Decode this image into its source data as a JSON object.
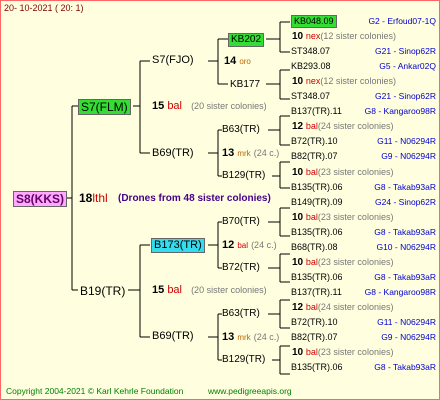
{
  "header": {
    "date": "20- 10-2021 ( 20: 1)"
  },
  "footer": {
    "copyright": "Copyright 2004-2021 © Karl Kehrle Foundation",
    "site": "www.pedigreeapis.org"
  },
  "colors": {
    "female_box": "#33dd33",
    "selected_box": "#33ddee",
    "root_box": "#ffaaff",
    "frame": "#ff6666",
    "lines": "#000000",
    "code_text": "#0000cc",
    "tag_text": "#cc0000"
  },
  "root": {
    "name": "S8(KKS)",
    "gen": "18",
    "tag": "lthl",
    "drones": "(Drones from 48 sister colonies)"
  },
  "g1": {
    "top": {
      "name": "S7(FLM)",
      "gen": "15",
      "tag": "bal",
      "note": "(20 sister colonies)"
    },
    "bottom": {
      "name": "B19(TR)",
      "gen": "15",
      "tag": "bal",
      "note": "(20 sister colonies)"
    }
  },
  "g2": {
    "a": {
      "name": "S7(FJO)",
      "gen": "14",
      "tag": "oro"
    },
    "b": {
      "name": "B69(TR)",
      "gen": "13",
      "tag": "mrk",
      "note": "(24 c.)"
    },
    "c": {
      "name": "B173(TR)",
      "gen": "12",
      "tag": "bal",
      "note": "(24 c.)"
    },
    "d": {
      "name": "B69(TR)",
      "gen": "13",
      "tag": "mrk",
      "note": "(24 c.)"
    }
  },
  "g3": {
    "a1": {
      "name": "KB202"
    },
    "a2": {
      "name": "KB177"
    },
    "b1": {
      "name": "B63(TR)",
      "gen": "12",
      "tag": "bal",
      "note": "(24 sister colonies)"
    },
    "b2": {
      "name": "B129(TR)",
      "gen": "10",
      "tag": "bal",
      "note": "(23 sister colonies)"
    },
    "c1": {
      "name": "B70(TR)",
      "gen": "10",
      "tag": "bal",
      "note": "(23 sister colonies)"
    },
    "c2": {
      "name": "B72(TR)",
      "gen": "10",
      "tag": "bal",
      "note": "(23 sister colonies)"
    },
    "d1": {
      "name": "B63(TR)",
      "gen": "12",
      "tag": "bal",
      "note": "(24 sister colonies)"
    },
    "d2": {
      "name": "B129(TR)",
      "gen": "10",
      "tag": "bal",
      "note": "(23 sister colonies)"
    }
  },
  "g4": [
    {
      "name": "KB048.09",
      "code": "G2 - Erfoud07-1Q"
    },
    {
      "gen": "10",
      "tag": "nex",
      "note": "(12 sister colonies)"
    },
    {
      "name": "ST348.07",
      "code": "G21 - Sinop62R"
    },
    {
      "name": "KB293.08",
      "code": "G5 - Ankar02Q"
    },
    {
      "gen": "10",
      "tag": "nex",
      "note": "(12 sister colonies)"
    },
    {
      "name": "ST348.07",
      "code": "G21 - Sinop62R"
    },
    {
      "name": "B137(TR).11",
      "code": "G8 - Kangaroo98R"
    },
    {
      "gen": "12",
      "tag": "bal",
      "note": "(24 sister colonies)"
    },
    {
      "name": "B72(TR).10",
      "code": "G11 - N06294R"
    },
    {
      "name": "B82(TR).07",
      "code": "G9 - N06294R"
    },
    {
      "gen": "10",
      "tag": "bal",
      "note": "(23 sister colonies)"
    },
    {
      "name": "B135(TR).06",
      "code": "G8 - Takab93aR"
    },
    {
      "name": "B149(TR).09",
      "code": "G24 - Sinop62R"
    },
    {
      "gen": "10",
      "tag": "bal",
      "note": "(23 sister colonies)"
    },
    {
      "name": "B135(TR).06",
      "code": "G8 - Takab93aR"
    },
    {
      "name": "B68(TR).08",
      "code": "G10 - N06294R"
    },
    {
      "gen": "10",
      "tag": "bal",
      "note": "(23 sister colonies)"
    },
    {
      "name": "B135(TR).06",
      "code": "G8 - Takab93aR"
    },
    {
      "name": "B137(TR).11",
      "code": "G8 - Kangaroo98R"
    },
    {
      "gen": "12",
      "tag": "bal",
      "note": "(24 sister colonies)"
    },
    {
      "name": "B72(TR).10",
      "code": "G11 - N06294R"
    },
    {
      "name": "B82(TR).07",
      "code": "G9 - N06294R"
    },
    {
      "gen": "10",
      "tag": "bal",
      "note": "(23 sister colonies)"
    },
    {
      "name": "B135(TR).06",
      "code": "G8 - Takab93aR"
    }
  ]
}
